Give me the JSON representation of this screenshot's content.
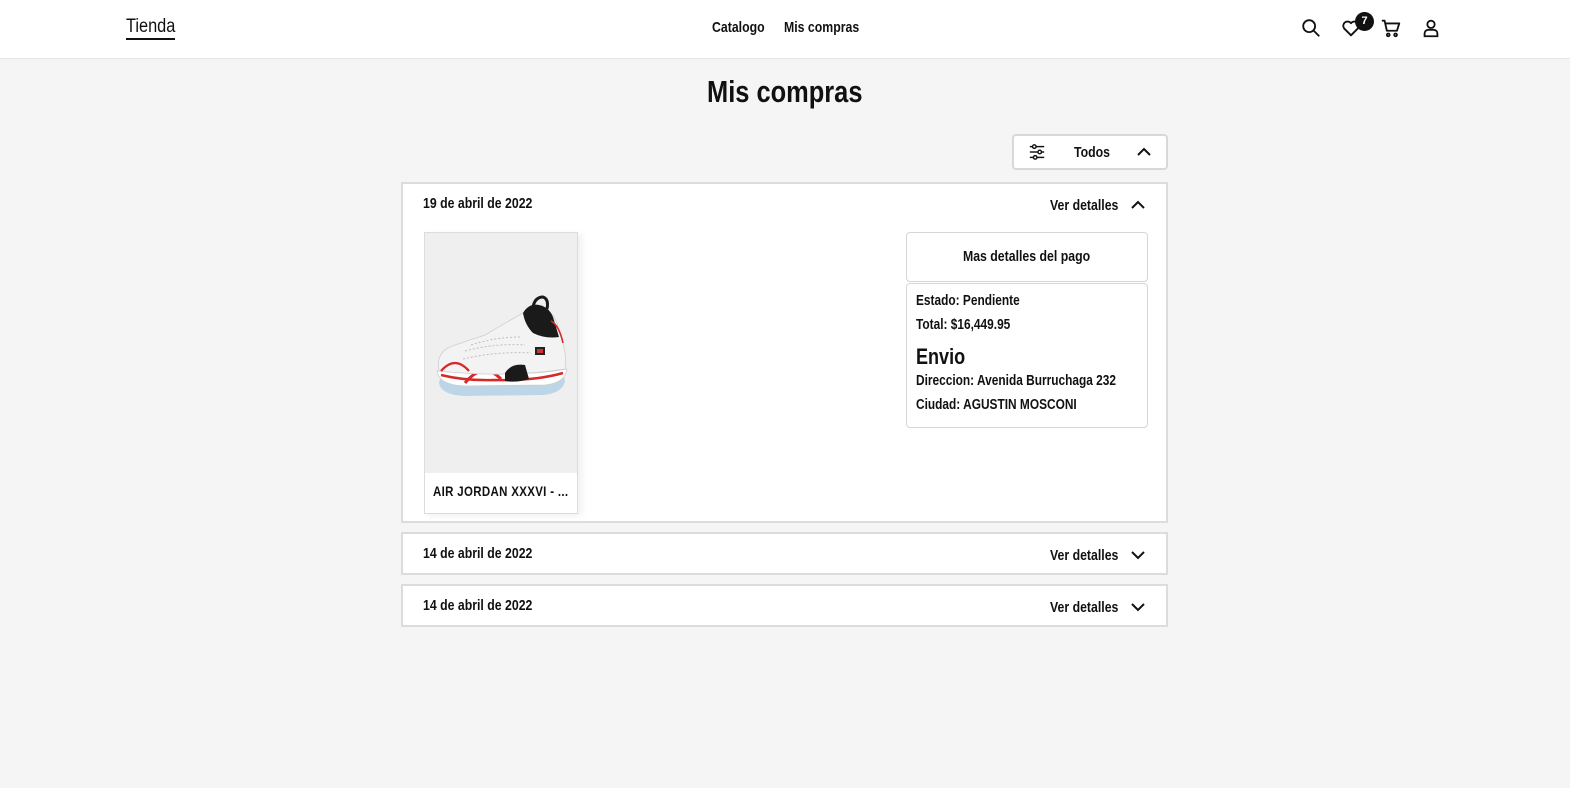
{
  "header": {
    "brand": "Tienda",
    "nav": [
      "Catalogo",
      "Mis compras"
    ],
    "icons": [
      "search-icon",
      "heart-icon",
      "cart-icon",
      "user-icon"
    ],
    "wishlist_count": "7"
  },
  "page": {
    "title": "Mis compras"
  },
  "filter": {
    "label": "Todos",
    "icon": "sliders-icon",
    "state": "expanded"
  },
  "orders": [
    {
      "date": "19 de abril de 2022",
      "details_label": "Ver detalles",
      "expanded": true,
      "products": [
        {
          "name": "AIR JORDAN XXXVI - ..."
        }
      ],
      "payment": {
        "button_label": "Mas detalles del pago",
        "status": "Estado: Pendiente",
        "total": "Total: $16,449.95",
        "shipping_heading": "Envio",
        "address": "Direccion: Avenida Burruchaga 232",
        "city": "Ciudad: AGUSTIN MOSCONI"
      }
    },
    {
      "date": "14 de abril de 2022",
      "details_label": "Ver detalles",
      "expanded": false
    },
    {
      "date": "14 de abril de 2022",
      "details_label": "Ver detalles",
      "expanded": false
    }
  ]
}
